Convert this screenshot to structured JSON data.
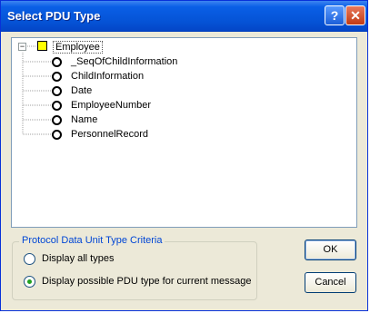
{
  "window": {
    "title": "Select PDU Type"
  },
  "titlebar": {
    "help_glyph": "?",
    "close_glyph": "✕"
  },
  "tree": {
    "root": {
      "label": "Employee",
      "expander": "−",
      "icon": "yellow-square-icon"
    },
    "children": [
      {
        "label": "_SeqOfChildInformation"
      },
      {
        "label": "ChildInformation"
      },
      {
        "label": "Date"
      },
      {
        "label": "EmployeeNumber"
      },
      {
        "label": "Name"
      },
      {
        "label": "PersonnelRecord"
      }
    ]
  },
  "criteria": {
    "title": "Protocol Data Unit Type Criteria",
    "options": [
      {
        "label": "Display all types",
        "selected": false
      },
      {
        "label": "Display possible PDU type for current message",
        "selected": true
      }
    ]
  },
  "buttons": {
    "ok": "OK",
    "cancel": "Cancel"
  }
}
